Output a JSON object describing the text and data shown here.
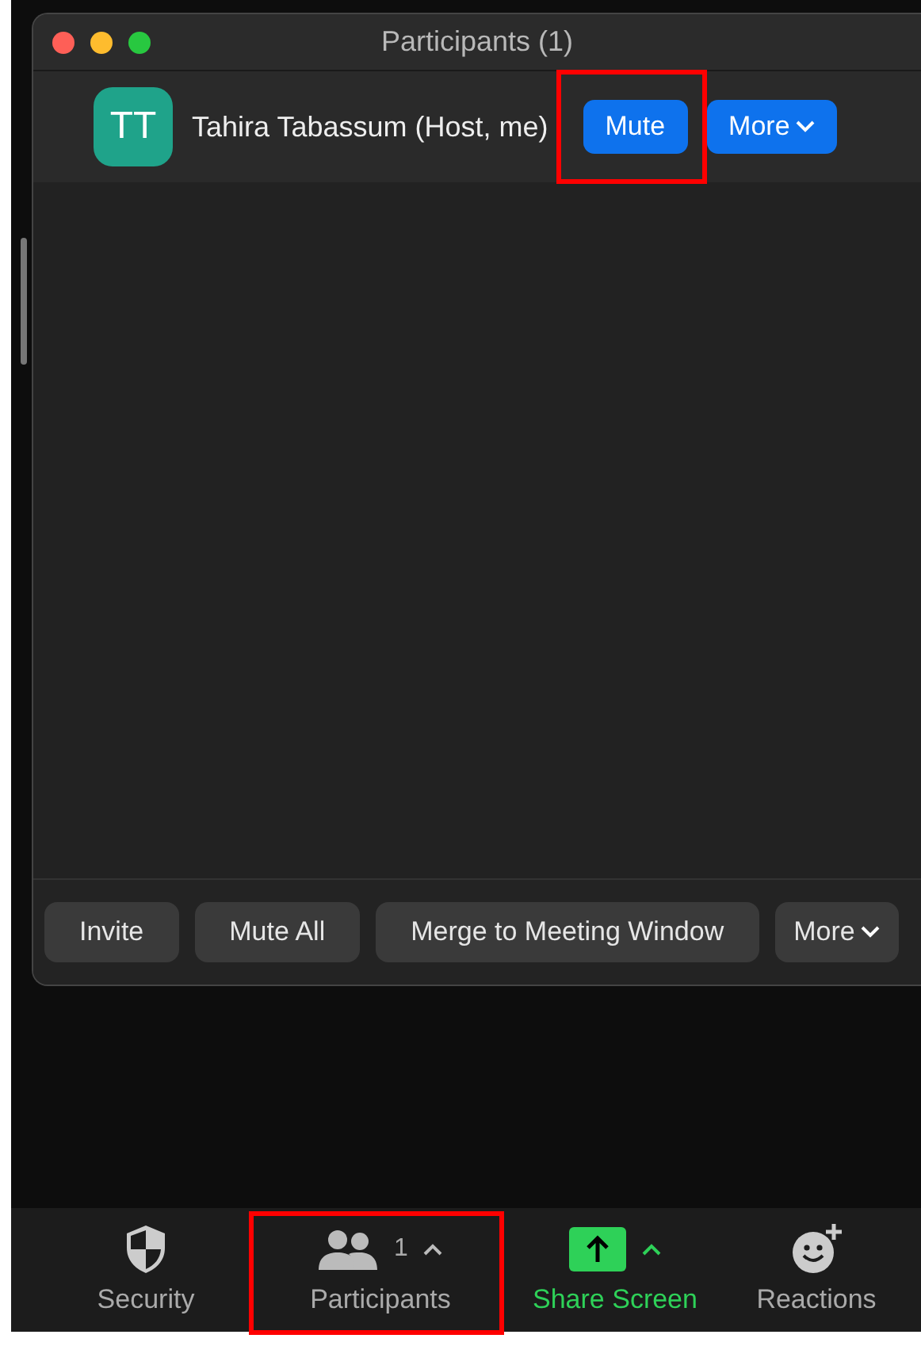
{
  "window": {
    "title": "Participants (1)"
  },
  "participants": [
    {
      "initials": "TT",
      "color": "#1fa38a",
      "name": "Tahira Tabassum (Host, me)",
      "actions": [
        {
          "label": "Mute",
          "highlighted": true
        },
        {
          "label": "More",
          "highlighted": false
        }
      ]
    }
  ],
  "footer_buttons": [
    {
      "label": "Invite",
      "dropdown": false
    },
    {
      "label": "Mute All",
      "dropdown": false
    },
    {
      "label": "Merge to Meeting Window",
      "dropdown": false
    },
    {
      "label": "More",
      "dropdown": true
    }
  ],
  "toolbar": [
    {
      "kind": "security",
      "label": "Security",
      "highlighted": false
    },
    {
      "kind": "participants",
      "label": "Participants",
      "count": "1",
      "highlighted": true
    },
    {
      "kind": "share",
      "label": "Share Screen",
      "highlighted": false
    },
    {
      "kind": "reactions",
      "label": "Reactions",
      "highlighted": false
    }
  ]
}
